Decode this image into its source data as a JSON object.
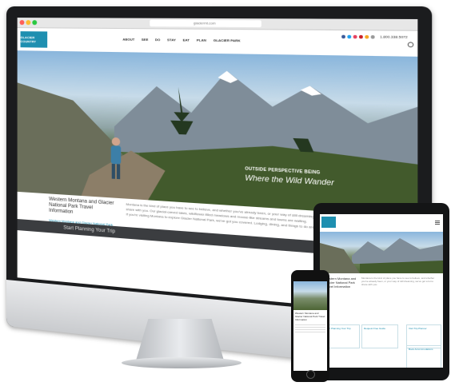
{
  "browser": {
    "url": "glaciermt.com"
  },
  "site": {
    "logo": "GLACIER COUNTRY",
    "nav": [
      "ABOUT",
      "SEE",
      "DO",
      "STAY",
      "EAT",
      "PLAN",
      "GLACIER PARK"
    ],
    "phone": "1.800.338.5072",
    "hero_tag_small": "OUTSIDE PERSPECTIVE BEING",
    "hero_tag_big": "Where the Wild Wander",
    "content_title": "Western Montana and Glacier National Park Travel Information",
    "content_link": "Western Montana and Glacier National Park Vacation Guide",
    "content_body": "Montana is the kind of place you have to see to believe, and whether you've already been, or your way of still dreaming, we'll talk about that basin, we've got a lot to share with you. Our glacial-carved lakes, wildflower-filled meadows and moose-like streams and towns are waiting.",
    "content_body2": "If you're visiting Montana to explore Glacier National Park, we've got you covered. Lodging, dining, and things to do are all right here.",
    "plan_bar": "Start Planning Your Trip"
  },
  "tablet": {
    "title": "Western Montana and Glacier National Park Travel Information",
    "body": "Montana is the kind of place you have to see to believe, and whether you've already been, or your way of still dreaming, we've got a lot to share with you.",
    "boxes": [
      "Start Planning Your Trip",
      "Request Free Guide",
      "Visit Trip Planner",
      "Book Accommodations"
    ]
  },
  "phone": {
    "title": "Western Montana and Glacier National Park Travel Information"
  }
}
